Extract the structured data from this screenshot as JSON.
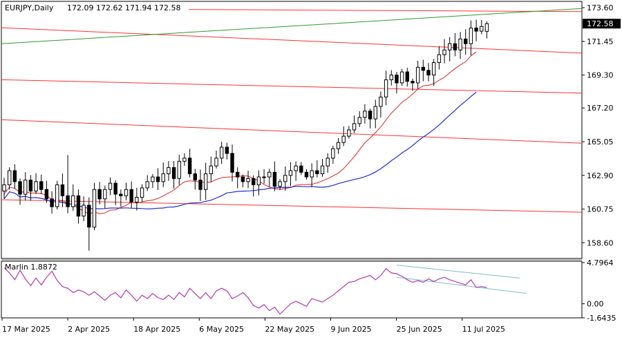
{
  "header": {
    "symbol_text": "EURJPY,Daily",
    "ohlc_text": "172.09 172.62 171.94 172.58"
  },
  "chart_data": [
    {
      "type": "candlestick",
      "title": "EURJPY,Daily",
      "ohlc_last": {
        "open": 172.09,
        "high": 172.62,
        "low": 171.94,
        "close": 172.58
      },
      "current_price_label": "172.58",
      "ylim": [
        157.6,
        174.0
      ],
      "y_ticks": [
        "173.60",
        "171.45",
        "169.30",
        "167.20",
        "165.05",
        "162.90",
        "160.75",
        "158.60"
      ],
      "x_ticks": [
        "17 Mar 2025",
        "2 Apr 2025",
        "18 Apr 2025",
        "6 May 2025",
        "22 May 2025",
        "9 Jun 2025",
        "25 Jun 2025",
        "11 Jul 2025"
      ],
      "closes": [
        162.3,
        163.2,
        162.5,
        161.7,
        162.6,
        161.9,
        162.5,
        162.0,
        161.4,
        160.9,
        162.3,
        161.6,
        160.9,
        161.6,
        160.3,
        161.0,
        159.6,
        162.0,
        161.4,
        162.0,
        162.4,
        161.7,
        161.6,
        162.0,
        161.2,
        161.5,
        162.1,
        162.5,
        162.8,
        162.5,
        163.0,
        163.4,
        162.7,
        163.8,
        164.0,
        163.0,
        162.6,
        162.0,
        163.0,
        163.5,
        164.0,
        164.7,
        164.3,
        163.1,
        162.8,
        162.5,
        162.7,
        162.3,
        162.8,
        162.8,
        163.1,
        162.2,
        162.5,
        162.9,
        163.2,
        163.5,
        163.1,
        162.8,
        163.2,
        163.0,
        163.5,
        164.0,
        164.6,
        165.0,
        165.4,
        165.8,
        166.2,
        166.6,
        167.0,
        166.5,
        167.3,
        167.9,
        169.0,
        169.3,
        168.8,
        169.5,
        168.9,
        168.8,
        169.8,
        169.6,
        169.3,
        170.1,
        170.6,
        170.9,
        171.3,
        170.9,
        171.6,
        171.3,
        172.3,
        172.1,
        172.4,
        172.58
      ],
      "series": [
        {
          "name": "",
          "color": "#dd2222"
        },
        {
          "name": "",
          "color": "#1f2bd6"
        }
      ],
      "horizontal_lines": [
        {
          "color": "#ff3030",
          "from": 173.55,
          "to": 173.35
        },
        {
          "color": "#ff3030",
          "from": 172.32,
          "to": 170.7
        },
        {
          "color": "#ff3030",
          "from": 169.0,
          "to": 168.15
        },
        {
          "color": "#ff3030",
          "from": 166.45,
          "to": 164.95
        },
        {
          "color": "#ff3030",
          "from": 161.35,
          "to": 160.55
        }
      ],
      "trend_lines": [
        {
          "color": "#2c9a2c",
          "from": 171.3,
          "to": 173.55
        }
      ]
    },
    {
      "type": "line",
      "title": "Marlin 1.8872",
      "indicator_name": "Marlin",
      "indicator_value": "1.8872",
      "ylim": [
        -1.6435,
        4.7964
      ],
      "y_ticks": [
        "4.7964",
        "0.00",
        "-1.6435"
      ],
      "values": [
        4.2,
        3.6,
        2.8,
        3.9,
        2.9,
        2.1,
        3.0,
        2.2,
        3.1,
        3.8,
        2.7,
        2.0,
        1.8,
        1.3,
        1.6,
        1.4,
        1.0,
        1.4,
        0.9,
        0.4,
        1.0,
        1.3,
        0.7,
        1.6,
        1.0,
        0.3,
        1.0,
        0.6,
        1.2,
        0.7,
        0.5,
        1.0,
        0.5,
        1.3,
        0.8,
        1.8,
        1.2,
        0.6,
        1.3,
        0.6,
        1.5,
        1.8,
        1.5,
        0.6,
        0.9,
        1.3,
        0.7,
        -0.2,
        -0.5,
        -0.1,
        -0.8,
        -0.4,
        -1.2,
        -0.6,
        0.0,
        0.3,
        0.0,
        -0.3,
        0.6,
        0.4,
        0.2,
        0.6,
        1.0,
        1.5,
        2.0,
        2.5,
        2.6,
        2.9,
        3.1,
        3.3,
        2.8,
        3.3,
        4.1,
        3.6,
        3.5,
        3.2,
        2.8,
        2.5,
        2.7,
        2.5,
        2.9,
        2.6,
        2.9,
        3.1,
        2.8,
        2.6,
        2.4,
        2.2,
        2.8,
        1.9,
        2.0,
        1.8872
      ],
      "channel": {
        "color": "#7fbdc4",
        "upper_from": 4.5,
        "upper_to": 3.0,
        "lower_from": 3.1,
        "lower_to": 1.2
      },
      "line_color": "#b33ab3"
    }
  ]
}
